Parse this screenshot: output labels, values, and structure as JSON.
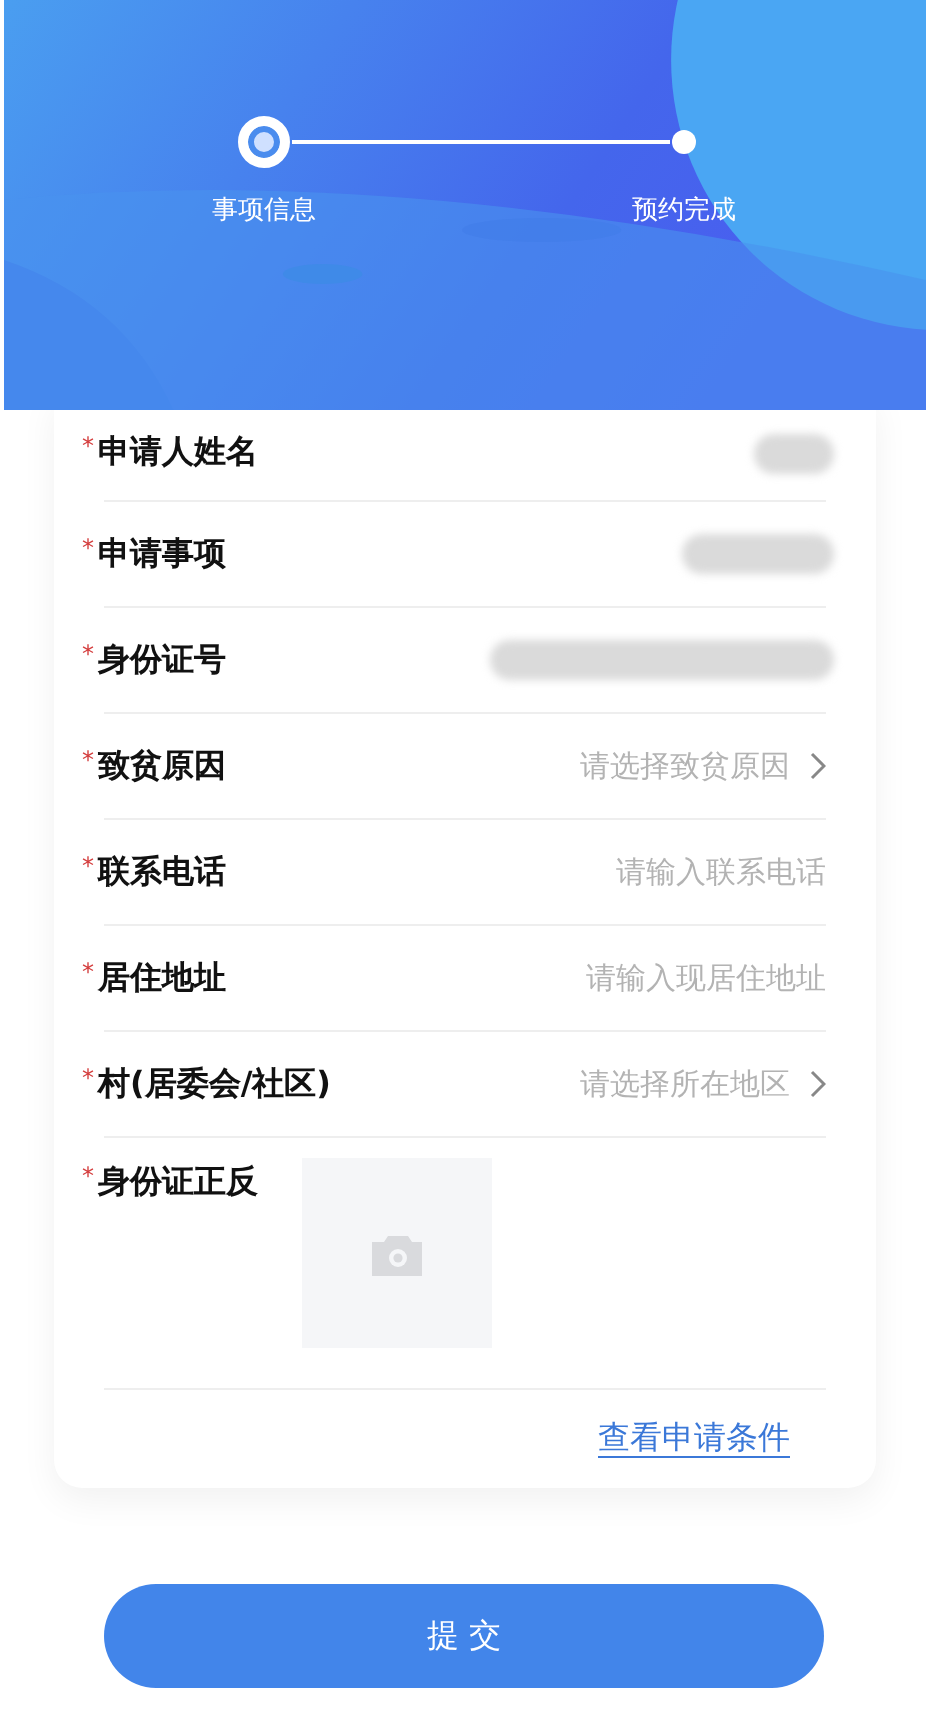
{
  "steps": [
    {
      "label": "事项信息",
      "selected": true
    },
    {
      "label": "预约完成",
      "selected": false
    }
  ],
  "form": {
    "fields": [
      {
        "required_mark": "*",
        "label": "申请人姓名",
        "kind": "redacted"
      },
      {
        "required_mark": "*",
        "label": "申请事项",
        "kind": "redacted"
      },
      {
        "required_mark": "*",
        "label": "身份证号",
        "kind": "redacted"
      },
      {
        "required_mark": "*",
        "label": "致贫原因",
        "kind": "select",
        "placeholder": "请选择致贫原因"
      },
      {
        "required_mark": "*",
        "label": "联系电话",
        "kind": "input",
        "placeholder": "请输入联系电话"
      },
      {
        "required_mark": "*",
        "label": "居住地址",
        "kind": "input",
        "placeholder": "请输入现居住地址"
      },
      {
        "required_mark": "*",
        "label": "村(居委会/社区)",
        "kind": "select",
        "placeholder": "请选择所在地区"
      },
      {
        "required_mark": "*",
        "label": "身份证正反",
        "kind": "upload"
      }
    ],
    "link": "查看申请条件"
  },
  "submit": "提 交"
}
